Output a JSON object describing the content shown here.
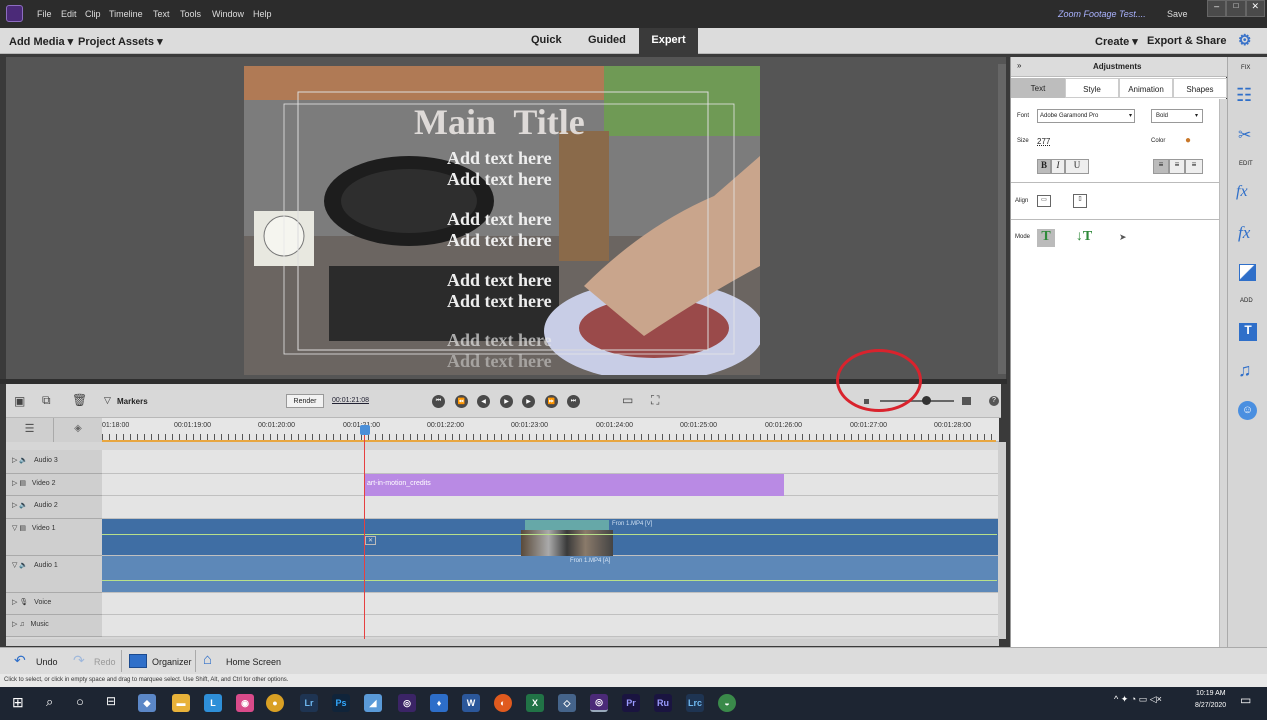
{
  "menubar": {
    "items": [
      "File",
      "Edit",
      "Clip",
      "Timeline",
      "Text",
      "Tools",
      "Window",
      "Help"
    ],
    "project_title": "Zoom Footage Test....",
    "save_label": "Save"
  },
  "toolbar": {
    "add_media": "Add Media",
    "project_assets": "Project Assets",
    "modes": [
      "Quick",
      "Guided",
      "Expert"
    ],
    "active_mode": "Expert",
    "create": "Create",
    "export_share": "Export & Share"
  },
  "monitor": {
    "title_text": "Main  Title",
    "lines": [
      "Add text here",
      "Add text here",
      "Add text here",
      "Add text here",
      "Add text here",
      "Add text here",
      "Add text here",
      "Add text here"
    ]
  },
  "timeline_controls": {
    "markers": "Markers",
    "render": "Render",
    "timecode": "00:01:21:08"
  },
  "ruler": {
    "ticks": [
      "01:18:00",
      "00:01:19:00",
      "00:01:20:00",
      "00:01:21:00",
      "00:01:22:00",
      "00:01:23:00",
      "00:01:24:00",
      "00:01:25:00",
      "00:01:26:00",
      "00:01:27:00",
      "00:01:28:00"
    ]
  },
  "tracks": {
    "names": [
      "Audio 3",
      "Video 2",
      "Audio 2",
      "Video 1",
      "Audio 1",
      "Voice",
      "Music"
    ],
    "clip_credits": "art-in-motion_credits",
    "clip_video": "Fron 1.MP4 [V]",
    "clip_audio": "Fron 1.MP4 [A]"
  },
  "adjustments": {
    "header": "Adjustments",
    "tabs": [
      "Text",
      "Style",
      "Animation",
      "Shapes"
    ],
    "active_tab": "Text",
    "font_label": "Font",
    "font_value": "Adobe Garamond Pro",
    "weight_value": "Bold",
    "size_label": "Size",
    "size_value": "277",
    "color_label": "Color",
    "bold": "B",
    "italic": "I",
    "underline": "U",
    "align_label": "Align",
    "mode_label": "Mode"
  },
  "rightbar": {
    "fix": "FIX",
    "edit": "EDIT",
    "add": "ADD"
  },
  "bottombar": {
    "undo": "Undo",
    "redo": "Redo",
    "organizer": "Organizer",
    "home": "Home Screen"
  },
  "statusbar": {
    "text": "Click to select, or click in empty space and drag to marquee select. Use Shift, Alt, and Ctrl for other options."
  },
  "taskbar": {
    "time": "10:19 AM",
    "date": "8/27/2020"
  },
  "colors": {
    "accent": "#d9232d",
    "credits_clip": "#b98ae4",
    "video_clip": "#3f6ea4",
    "audio_clip": "#5d88b8",
    "playhead": "#e64040"
  }
}
